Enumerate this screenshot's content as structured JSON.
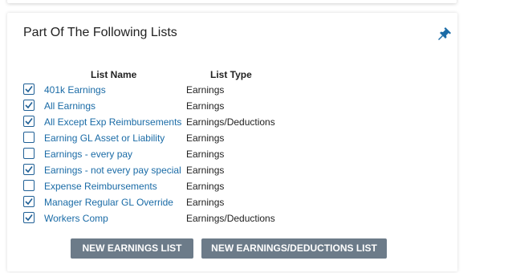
{
  "panel": {
    "title": "Part Of The Following Lists",
    "pin_icon": "pin-icon"
  },
  "table": {
    "headers": {
      "name": "List Name",
      "type": "List Type"
    },
    "rows": [
      {
        "name": "401k Earnings",
        "type": "Earnings",
        "checked": true
      },
      {
        "name": "All Earnings",
        "type": "Earnings",
        "checked": true
      },
      {
        "name": "All Except Exp Reimbursements",
        "type": "Earnings/Deductions",
        "checked": true
      },
      {
        "name": "Earning GL Asset or Liability",
        "type": "Earnings",
        "checked": false
      },
      {
        "name": "Earnings - every pay",
        "type": "Earnings",
        "checked": false
      },
      {
        "name": "Earnings - not every pay special",
        "type": "Earnings",
        "checked": true
      },
      {
        "name": "Expense Reimbursements",
        "type": "Earnings",
        "checked": false
      },
      {
        "name": "Manager Regular GL Override",
        "type": "Earnings",
        "checked": true
      },
      {
        "name": "Workers Comp",
        "type": "Earnings/Deductions",
        "checked": true
      }
    ]
  },
  "buttons": {
    "new_earnings_list": "NEW EARNINGS LIST",
    "new_earnings_deductions_list": "NEW EARNINGS/DEDUCTIONS LIST"
  },
  "colors": {
    "link": "#1a6ba6",
    "button_bg": "#6c7b89",
    "checkbox_border": "#1f5f95"
  }
}
